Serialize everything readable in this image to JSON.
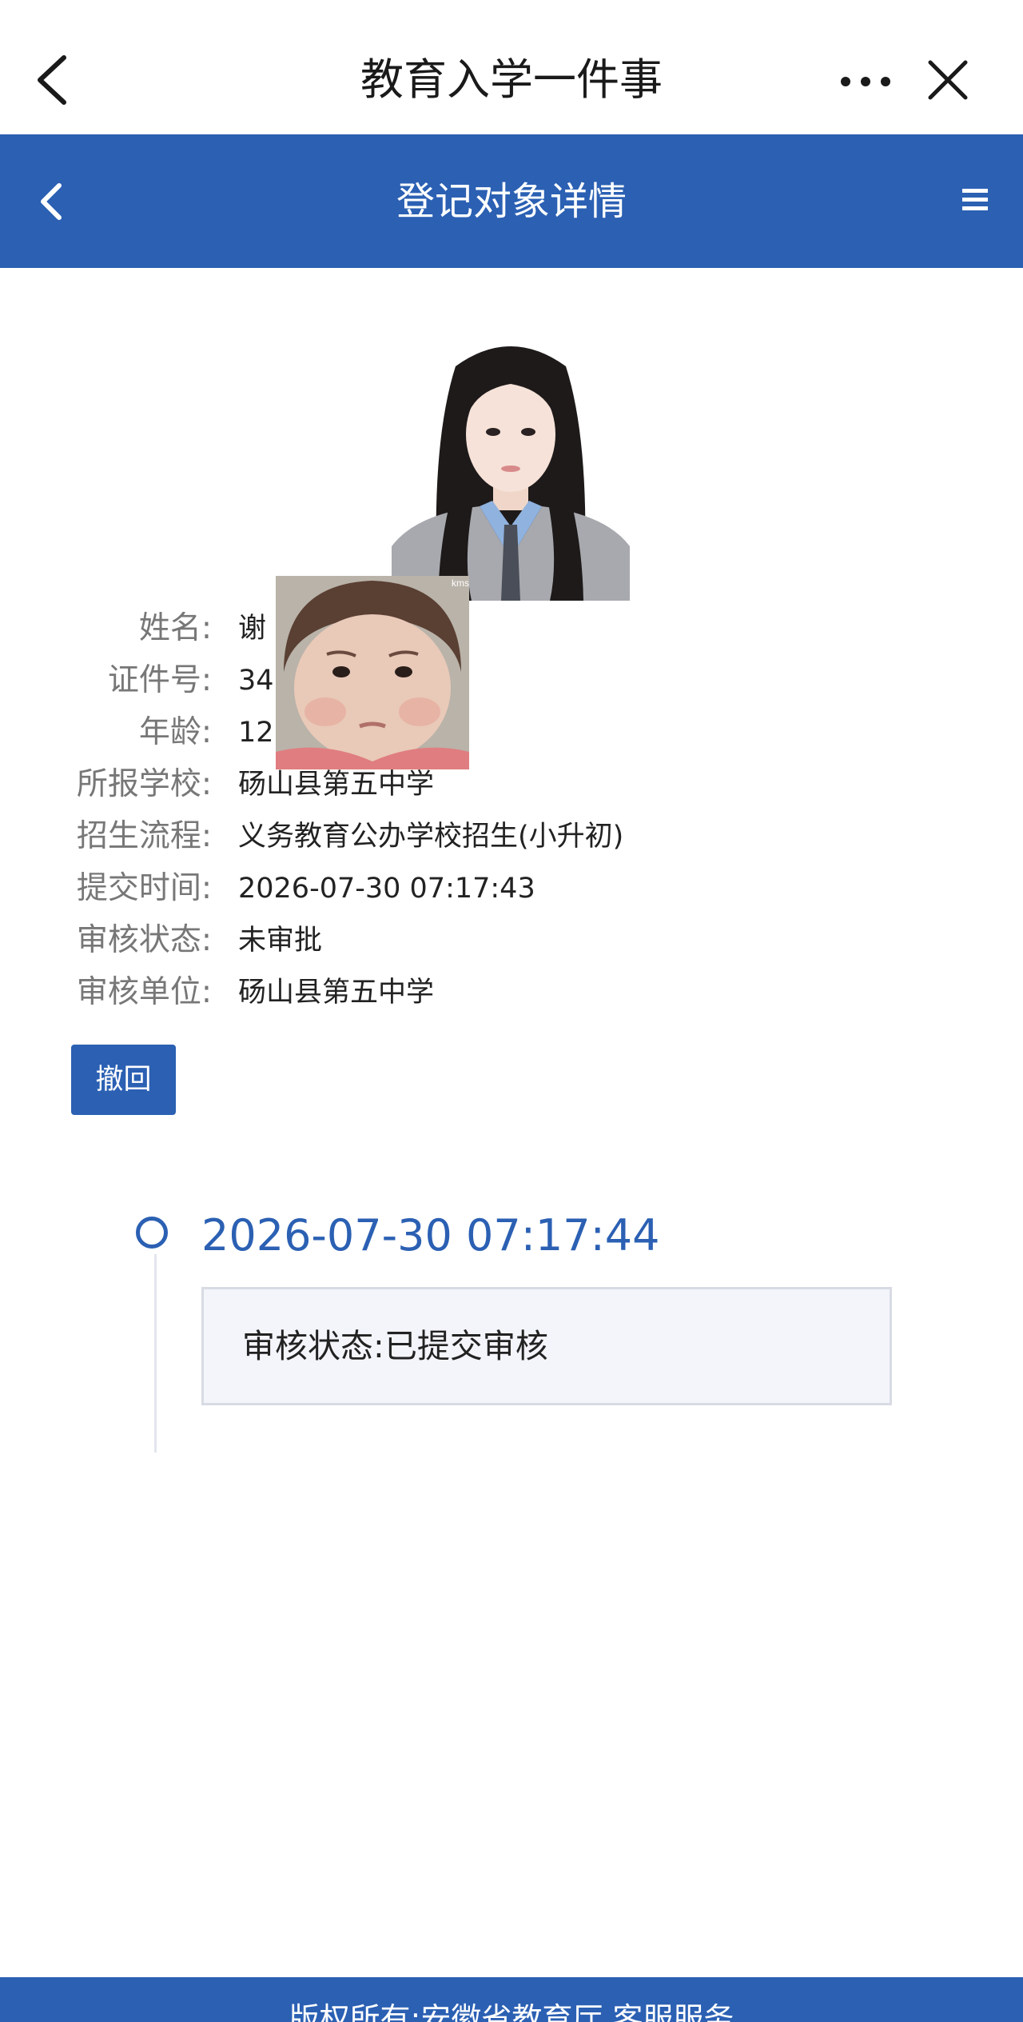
{
  "topnav": {
    "title": "教育入学一件事",
    "back_icon": "chevron-left-icon",
    "more_icon": "more-dots-icon",
    "close_icon": "close-icon"
  },
  "header": {
    "title": "登记对象详情",
    "back_icon": "chevron-left-icon",
    "menu_icon": "hamburger-menu-icon",
    "background": "#2b60b3"
  },
  "info": {
    "rows": [
      {
        "label": "姓名:",
        "value": "谢"
      },
      {
        "label": "证件号:",
        "value": "34                    1545"
      },
      {
        "label": "年龄:",
        "value": "12(                    女"
      },
      {
        "label": "所报学校:",
        "value": "砀山县第五中学"
      },
      {
        "label": "招生流程:",
        "value": "义务教育公办学校招生(小升初)"
      },
      {
        "label": "提交时间:",
        "value": "2026-07-30 07:17:43"
      },
      {
        "label": "审核状态:",
        "value": "未审批"
      },
      {
        "label": "审核单位:",
        "value": "砀山县第五中学"
      }
    ]
  },
  "actions": {
    "withdraw_label": "撤回"
  },
  "sticker": {
    "watermark": "kms"
  },
  "timeline": {
    "items": [
      {
        "time": "2026-07-30 07:17:44",
        "text": "审核状态:已提交审核"
      }
    ]
  },
  "footer": {
    "text": "版权所有:安徽省教育厅 客服服务"
  },
  "colors": {
    "accent": "#2b60b3",
    "label": "#777777",
    "value": "#222222",
    "card_bg": "#f4f5fb"
  }
}
